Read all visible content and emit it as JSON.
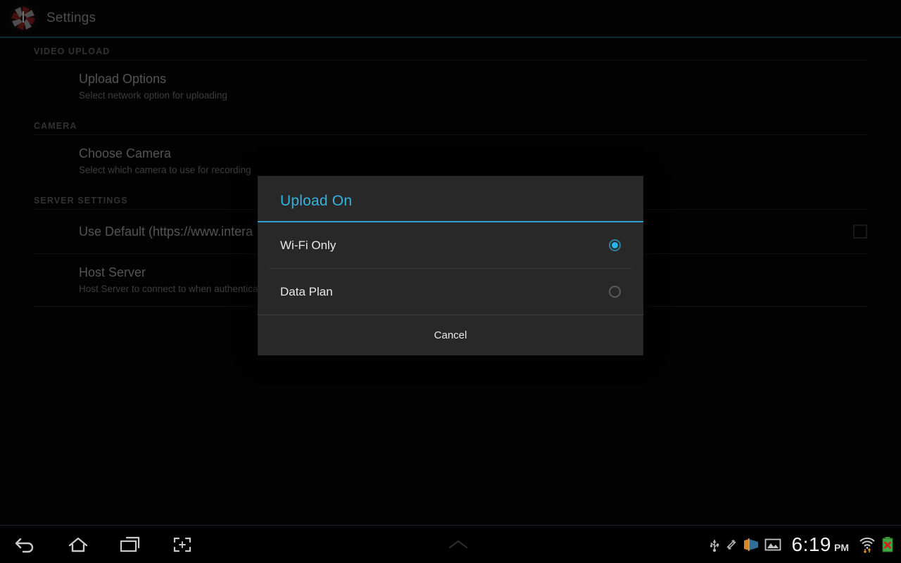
{
  "actionbar": {
    "app_icon": "camera-aperture-icon",
    "title": "Settings",
    "accent_underline_color": "#1d4a63"
  },
  "settings": {
    "sections": [
      {
        "header": "VIDEO UPLOAD",
        "rows": [
          {
            "title": "Upload Options",
            "summary": "Select network option for uploading",
            "has_checkbox": false
          }
        ]
      },
      {
        "header": "CAMERA",
        "rows": [
          {
            "title": "Choose Camera",
            "summary": "Select which camera to use for recording",
            "has_checkbox": false
          }
        ]
      },
      {
        "header": "SERVER SETTINGS",
        "rows": [
          {
            "title": "Use Default (https://www.intera",
            "summary": "",
            "has_checkbox": true,
            "checked": false
          },
          {
            "title": "Host Server",
            "summary": "Host Server to connect to when authentica",
            "has_checkbox": false
          }
        ]
      }
    ]
  },
  "dialog": {
    "title": "Upload On",
    "title_color": "#34b3e0",
    "options": [
      {
        "label": "Wi-Fi Only",
        "selected": true
      },
      {
        "label": "Data Plan",
        "selected": false
      }
    ],
    "cancel_label": "Cancel"
  },
  "systembar": {
    "nav": [
      {
        "name": "back-icon"
      },
      {
        "name": "home-icon"
      },
      {
        "name": "recent-apps-icon"
      },
      {
        "name": "screenshot-icon"
      }
    ],
    "shade_handle": "chevron-up-icon",
    "status_icons": [
      "usb-icon",
      "adb-debug-icon",
      "cast-projection-icon",
      "screenshot-image-icon"
    ],
    "clock_time": "6:19",
    "clock_ampm": "PM",
    "wifi_icon": "wifi-signal-icon",
    "battery_icon": "battery-error-icon"
  }
}
